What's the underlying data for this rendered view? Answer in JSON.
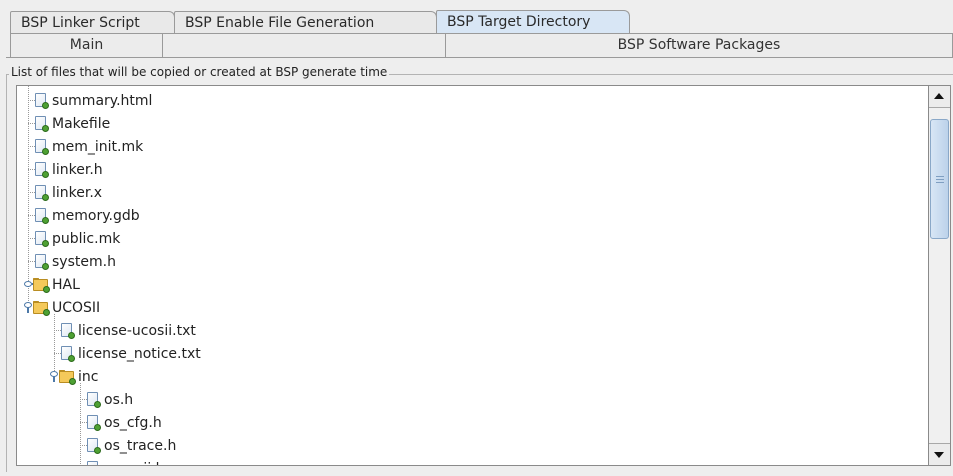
{
  "tabs_top": [
    {
      "label": "BSP Linker Script",
      "active": false
    },
    {
      "label": "BSP Enable File Generation",
      "active": false
    },
    {
      "label": "BSP Target Directory",
      "active": true
    }
  ],
  "tabs_bottom": [
    {
      "label": "Main"
    },
    {
      "label": ""
    },
    {
      "label": "BSP Software Packages"
    }
  ],
  "group": {
    "title": "List of files that will be copied or created at BSP generate time"
  },
  "tree": {
    "items": [
      {
        "label": "summary.html",
        "type": "file",
        "depth": 0
      },
      {
        "label": "Makefile",
        "type": "file",
        "depth": 0
      },
      {
        "label": "mem_init.mk",
        "type": "file",
        "depth": 0
      },
      {
        "label": "linker.h",
        "type": "file",
        "depth": 0
      },
      {
        "label": "linker.x",
        "type": "file",
        "depth": 0
      },
      {
        "label": "memory.gdb",
        "type": "file",
        "depth": 0
      },
      {
        "label": "public.mk",
        "type": "file",
        "depth": 0
      },
      {
        "label": "system.h",
        "type": "file",
        "depth": 0
      },
      {
        "label": "HAL",
        "type": "folder",
        "depth": 0,
        "expanded": false
      },
      {
        "label": "UCOSII",
        "type": "folder",
        "depth": 0,
        "expanded": true
      },
      {
        "label": "license-ucosii.txt",
        "type": "file",
        "depth": 1
      },
      {
        "label": "license_notice.txt",
        "type": "file",
        "depth": 1
      },
      {
        "label": "inc",
        "type": "folder",
        "depth": 1,
        "expanded": true
      },
      {
        "label": "os.h",
        "type": "file",
        "depth": 2
      },
      {
        "label": "os_cfg.h",
        "type": "file",
        "depth": 2
      },
      {
        "label": "os_trace.h",
        "type": "file",
        "depth": 2
      },
      {
        "label": "ucos_ii.h",
        "type": "file",
        "depth": 2
      }
    ]
  },
  "colors": {
    "active_tab": "#d8e6f5",
    "file_icon_dot": "#4ea133",
    "folder": "#f4c95a"
  }
}
